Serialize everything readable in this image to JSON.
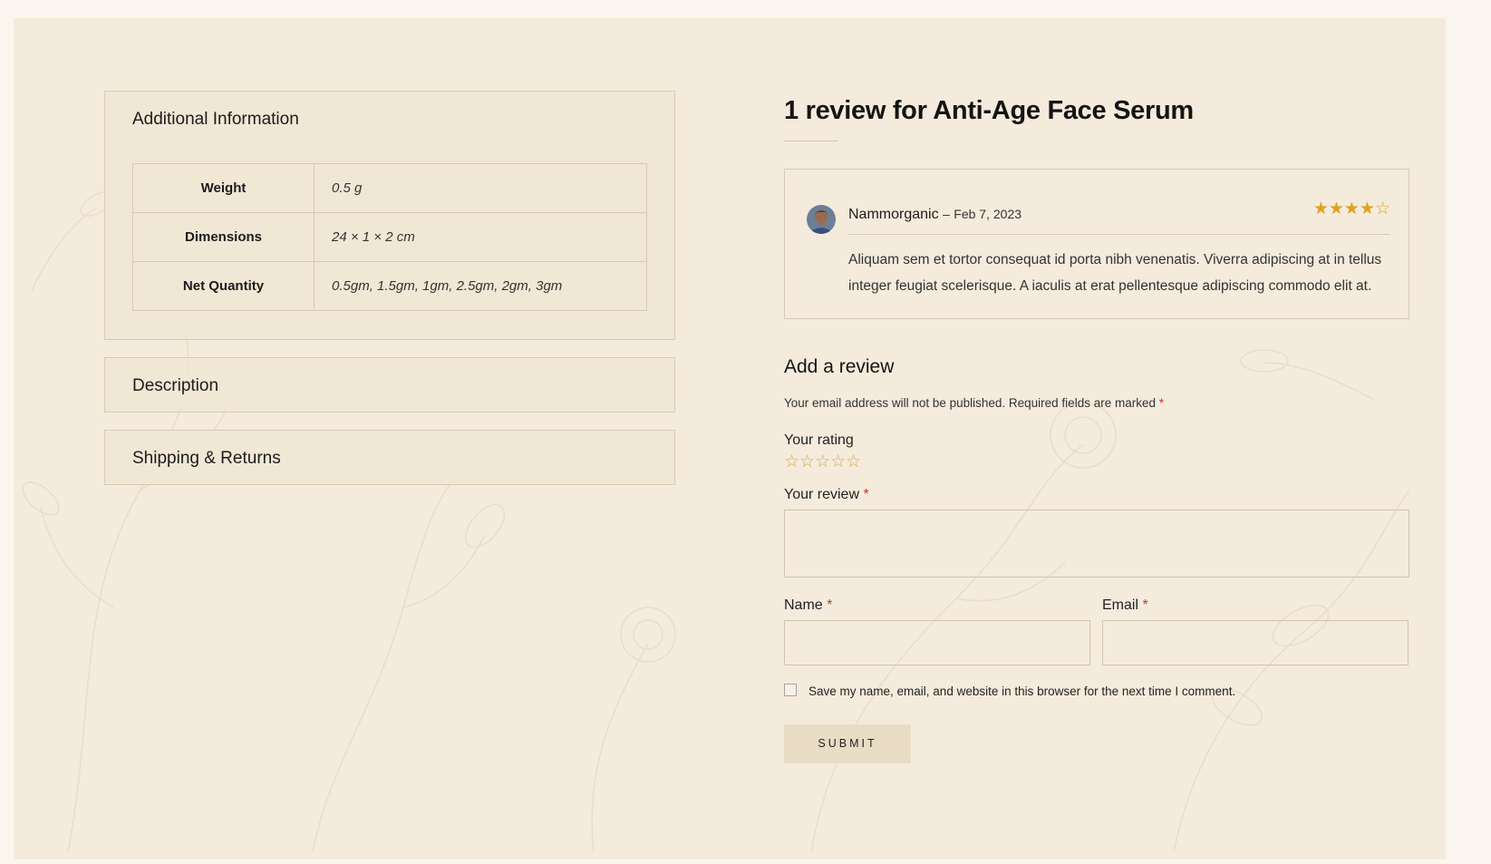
{
  "additional_info": {
    "title": "Additional Information",
    "rows": [
      {
        "label": "Weight",
        "value": "0.5 g"
      },
      {
        "label": "Dimensions",
        "value": "24 × 1 × 2 cm"
      },
      {
        "label": "Net Quantity",
        "value": "0.5gm, 1.5gm, 1gm, 2.5gm, 2gm, 3gm"
      }
    ]
  },
  "description": {
    "title": "Description"
  },
  "shipping": {
    "title": "Shipping & Returns"
  },
  "reviews": {
    "title": "1 review for Anti-Age Face Serum",
    "items": [
      {
        "author": "Nammorganic",
        "date": "Feb 7, 2023",
        "separator": "–",
        "rating": 4,
        "max_rating": 5,
        "stars": "★★★★☆",
        "text": "Aliquam sem et tortor consequat id porta nibh venenatis. Viverra adipiscing at in tellus integer feugiat scelerisque. A iaculis at erat pellentesque adipiscing commodo elit at."
      }
    ]
  },
  "add_review": {
    "title": "Add a review",
    "notice": "Your email address will not be published. Required fields are marked",
    "required_mark": "*",
    "rating_label": "Your rating",
    "rating_stars": "☆☆☆☆☆",
    "review_label": "Your review",
    "review_value": "",
    "name_label": "Name",
    "name_value": "",
    "email_label": "Email",
    "email_value": "",
    "save_label": "Save my name, email, and website in this browser for the next time I comment.",
    "save_checked": false,
    "submit_label": "SUBMIT"
  },
  "colors": {
    "page_bg": "#f4ebdc",
    "star": "#e0a21e",
    "required": "#c0392b",
    "button_bg": "#e9dcc4"
  }
}
